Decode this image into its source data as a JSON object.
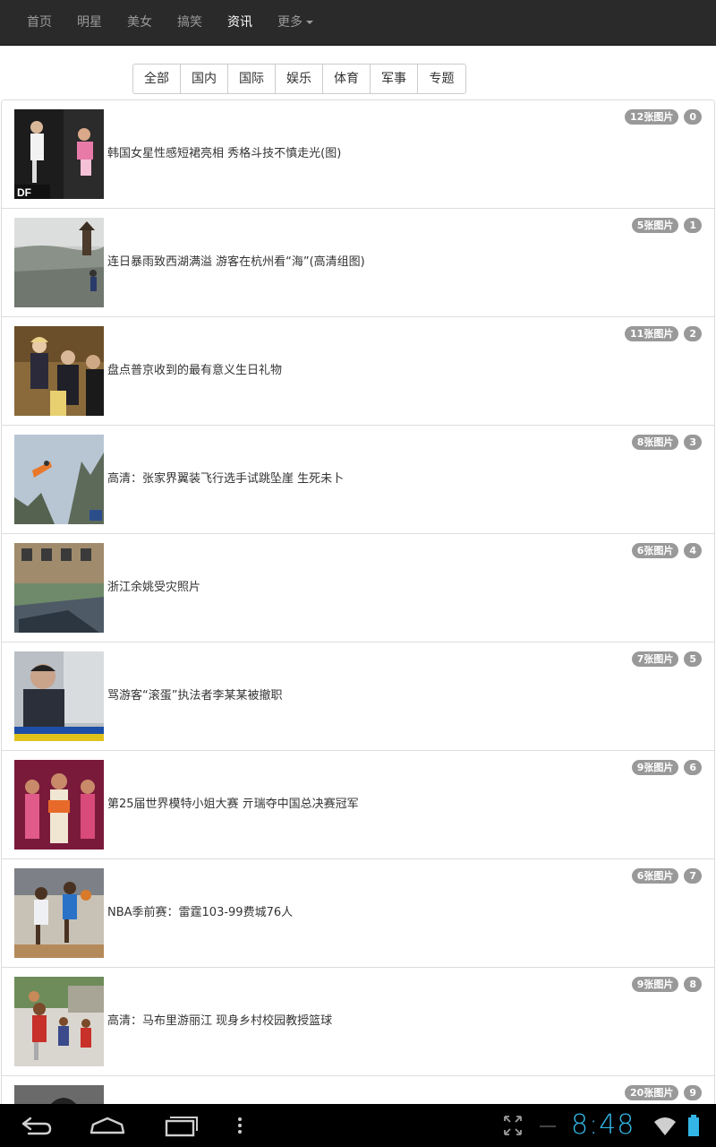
{
  "navbar": {
    "items": [
      {
        "label": "首页"
      },
      {
        "label": "明星"
      },
      {
        "label": "美女"
      },
      {
        "label": "搞笑"
      },
      {
        "label": "资讯"
      },
      {
        "label": "更多"
      }
    ],
    "active_index": 4
  },
  "categories": [
    "全部",
    "国内",
    "国际",
    "娱乐",
    "体育",
    "军事",
    "专题"
  ],
  "articles": [
    {
      "title": "韩国女星性感短裙亮相 秀格斗技不慎走光(图)",
      "photos": "12张图片",
      "index": "0",
      "thumb": "thumb-fight"
    },
    {
      "title": "连日暴雨致西湖满溢 游客在杭州看“海”(高清组图)",
      "photos": "5张图片",
      "index": "1",
      "thumb": "thumb-lake"
    },
    {
      "title": "盘点普京收到的最有意义生日礼物",
      "photos": "11张图片",
      "index": "2",
      "thumb": "thumb-meeting"
    },
    {
      "title": "高清：张家界翼装飞行选手试跳坠崖 生死未卜",
      "photos": "8张图片",
      "index": "3",
      "thumb": "thumb-wingsuit"
    },
    {
      "title": "浙江余姚受灾照片",
      "photos": "6张图片",
      "index": "4",
      "thumb": "thumb-flood"
    },
    {
      "title": "骂游客“滚蛋”执法者李某某被撤职",
      "photos": "7张图片",
      "index": "5",
      "thumb": "thumb-officer"
    },
    {
      "title": "第25届世界模特小姐大赛 亓瑞夺中国总决赛冠军",
      "photos": "9张图片",
      "index": "6",
      "thumb": "thumb-pageant"
    },
    {
      "title": "NBA季前赛：雷霆103-99费城76人",
      "photos": "6张图片",
      "index": "7",
      "thumb": "thumb-basketball"
    },
    {
      "title": "高清：马布里游丽江 现身乡村校园教授篮球",
      "photos": "9张图片",
      "index": "8",
      "thumb": "thumb-school"
    },
    {
      "title": "",
      "photos": "20张图片",
      "index": "9",
      "thumb": "thumb-portrait"
    }
  ],
  "system_bar": {
    "clock": "8:48",
    "icons": [
      "back-icon",
      "home-icon",
      "recent-apps-icon",
      "menu-icon",
      "screen-compat-icon",
      "wifi-icon",
      "battery-icon"
    ],
    "clock_color": "#33b5e5"
  },
  "colors": {
    "navbar_bg": "#2a2a2a",
    "badge_bg": "#999999",
    "border": "#dddddd"
  }
}
